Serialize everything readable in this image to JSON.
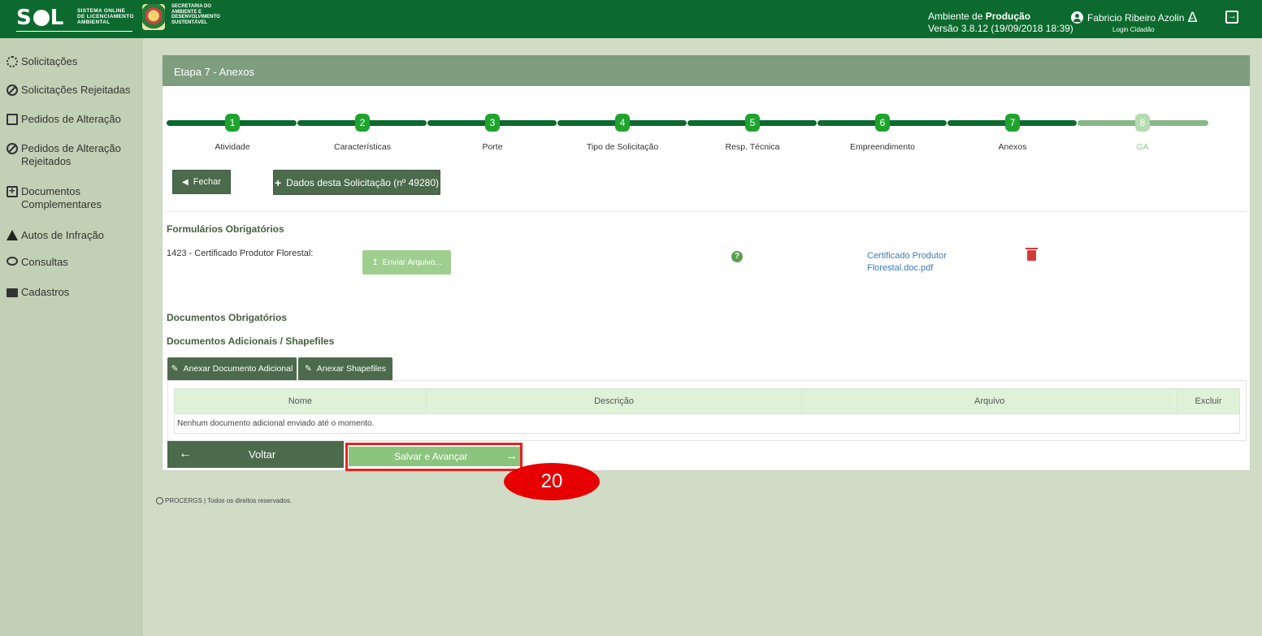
{
  "header": {
    "logo": "SOL",
    "logo_sub": "SISTEMA ONLINE DE LICENCIAMENTO AMBIENTAL",
    "secretaria": "SECRETARIA DO AMBIENTE E DESENVOLVIMENTO SUSTENTÁVEL",
    "env_prefix": "Ambiente de ",
    "env_name": "Produção",
    "version": "Versão 3.8.12 (19/09/2018 18:39)",
    "user_name": "Fabricio Ribeiro Azolin",
    "login_type": "Login Cidadão"
  },
  "sidebar": {
    "items": [
      {
        "label": "Solicitações",
        "icon": "sun-icon"
      },
      {
        "label": "Solicitações Rejeitadas",
        "icon": "ban-icon"
      },
      {
        "label": "Pedidos de Alteração",
        "icon": "clipboard-icon"
      },
      {
        "label": "Pedidos de Alteração Rejeitados",
        "icon": "ban-icon"
      },
      {
        "label": "Documentos Complementares",
        "icon": "plus-square-icon"
      },
      {
        "label": "Autos de Infração",
        "icon": "warning-icon"
      },
      {
        "label": "Consultas",
        "icon": "search-icon"
      },
      {
        "label": "Cadastros",
        "icon": "folder-icon"
      }
    ]
  },
  "panel": {
    "title": "Etapa 7 - Anexos",
    "steps": [
      {
        "num": "1",
        "label": "Atividade",
        "active": true
      },
      {
        "num": "2",
        "label": "Características",
        "active": true
      },
      {
        "num": "3",
        "label": "Porte",
        "active": true
      },
      {
        "num": "4",
        "label": "Tipo de Solicitação",
        "active": true
      },
      {
        "num": "5",
        "label": "Resp. Técnica",
        "active": true
      },
      {
        "num": "6",
        "label": "Empreendimento",
        "active": true
      },
      {
        "num": "7",
        "label": "Anexos",
        "active": true
      },
      {
        "num": "8",
        "label": "GA",
        "active": false
      }
    ],
    "fechar_label": "Fechar",
    "dados_label": "Dados desta Solicitação (nº 49280)",
    "formularios_title": "Formulários Obrigatórios",
    "form_item_label": "1423 - Certificado Produtor Florestal:",
    "enviar_label": "Enviar Arquivo...",
    "file_link_line1": "Certificado Produtor",
    "file_link_line2": "Florestal.doc.pdf",
    "documentos_title": "Documentos Obrigatórios",
    "adicionais_title": "Documentos Adicionais / Shapefiles",
    "anexar_doc_label": "Anexar Documento Adicional",
    "anexar_shape_label": "Anexar Shapefiles",
    "table": {
      "headers": [
        "Nome",
        "Descrição",
        "Arquivo",
        "Excluir"
      ],
      "empty_message": "Nenhum documento adicional enviado até o momento."
    },
    "voltar_label": "Voltar",
    "salvar_label": "Salvar e Avançar"
  },
  "annotation": {
    "number": "20"
  },
  "footer": {
    "text": "PROCERGS | Todos os direitos reservados."
  },
  "colors": {
    "primary": "#0c6a2e",
    "step_active": "#0c6a2e",
    "step_inactive": "#86b886",
    "highlight": "#e8211c"
  }
}
